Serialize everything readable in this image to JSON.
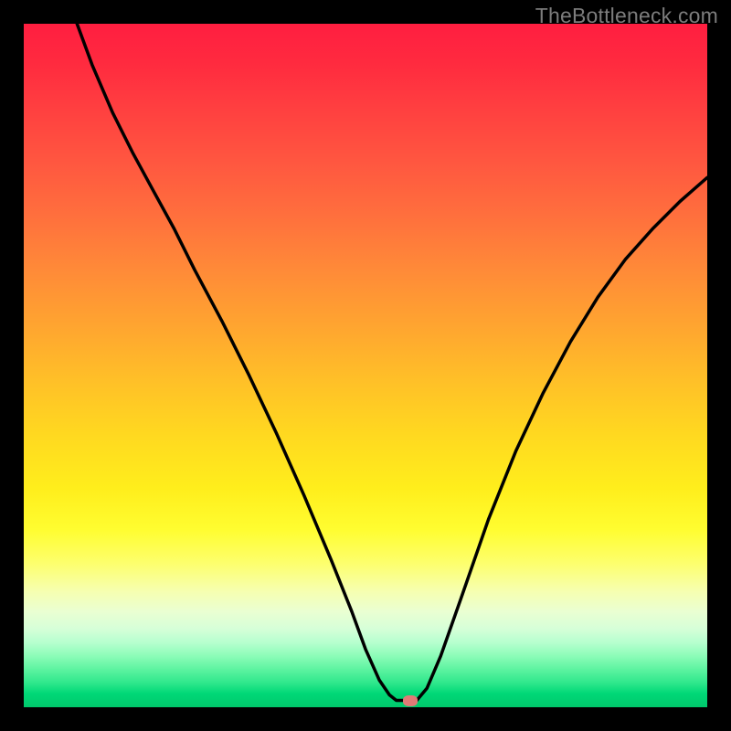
{
  "watermark": "TheBottleneck.com",
  "colors": {
    "background": "#000000",
    "watermark": "#7c7c7c",
    "curve": "#000000",
    "marker": "#e17a76"
  },
  "chart_data": {
    "type": "line",
    "title": "",
    "xlabel": "",
    "ylabel": "",
    "xlim": [
      0,
      1
    ],
    "ylim": [
      0,
      1
    ],
    "grid": false,
    "legend": false,
    "polyline_points": [
      [
        0.078,
        1.0
      ],
      [
        0.1,
        0.94
      ],
      [
        0.13,
        0.87
      ],
      [
        0.16,
        0.81
      ],
      [
        0.19,
        0.755
      ],
      [
        0.22,
        0.7
      ],
      [
        0.25,
        0.64
      ],
      [
        0.29,
        0.565
      ],
      [
        0.33,
        0.485
      ],
      [
        0.37,
        0.4
      ],
      [
        0.41,
        0.31
      ],
      [
        0.45,
        0.215
      ],
      [
        0.48,
        0.14
      ],
      [
        0.5,
        0.085
      ],
      [
        0.52,
        0.04
      ],
      [
        0.535,
        0.018
      ],
      [
        0.545,
        0.01
      ],
      [
        0.56,
        0.01
      ],
      [
        0.575,
        0.01
      ],
      [
        0.59,
        0.028
      ],
      [
        0.61,
        0.075
      ],
      [
        0.64,
        0.16
      ],
      [
        0.68,
        0.275
      ],
      [
        0.72,
        0.375
      ],
      [
        0.76,
        0.46
      ],
      [
        0.8,
        0.535
      ],
      [
        0.84,
        0.6
      ],
      [
        0.88,
        0.655
      ],
      [
        0.92,
        0.7
      ],
      [
        0.96,
        0.74
      ],
      [
        1.0,
        0.775
      ]
    ],
    "marker": {
      "x": 0.565,
      "y": 0.01
    }
  }
}
